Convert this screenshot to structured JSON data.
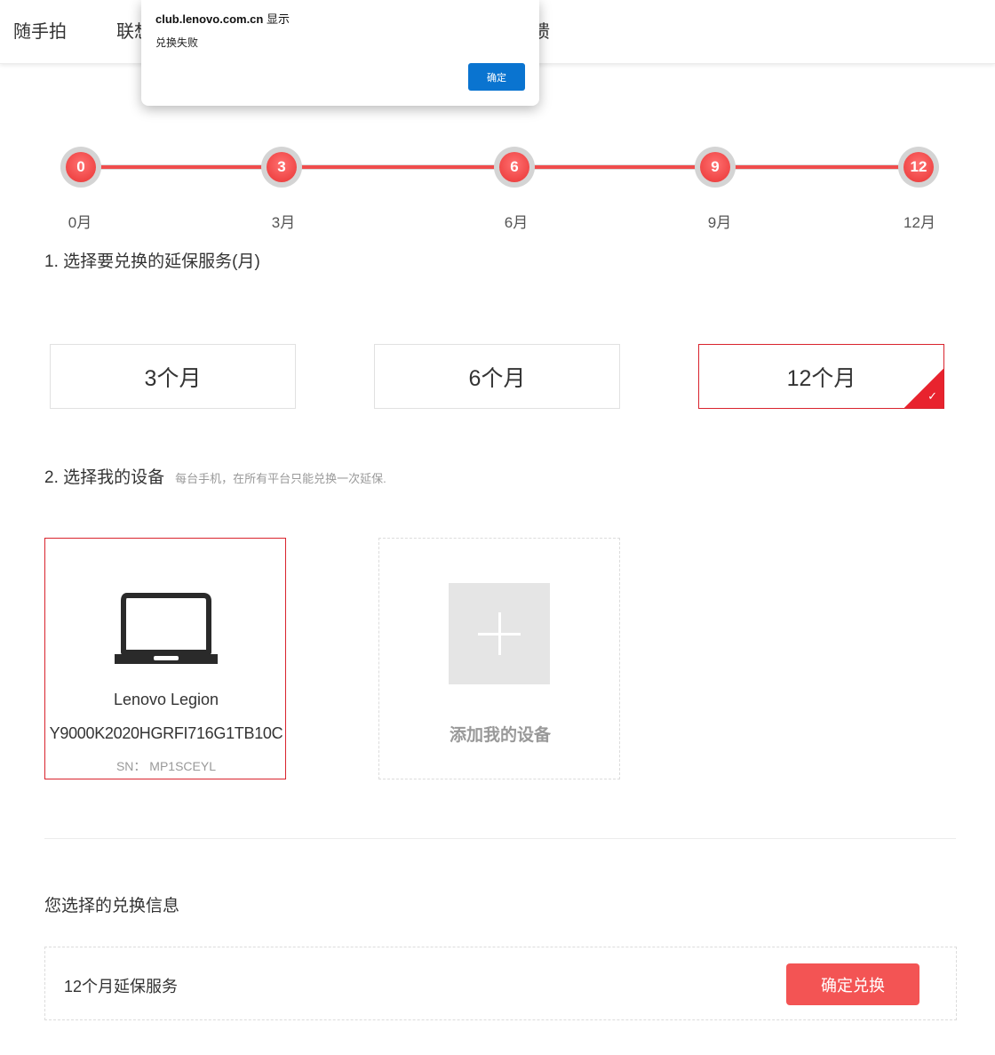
{
  "nav": {
    "items": [
      "随手拍",
      "联想",
      "馈"
    ]
  },
  "dialog": {
    "title_host": "club.lenovo.com.cn",
    "title_suffix": "显示",
    "message": "兑换失败",
    "ok_label": "确定"
  },
  "timeline": {
    "nodes": [
      {
        "value": "0",
        "label": "0月"
      },
      {
        "value": "3",
        "label": "3月"
      },
      {
        "value": "6",
        "label": "6月"
      },
      {
        "value": "9",
        "label": "9月"
      },
      {
        "value": "12",
        "label": "12月"
      }
    ]
  },
  "step1": {
    "title": "1. 选择要兑换的延保服务(月)",
    "options": [
      "3个月",
      "6个月",
      "12个月"
    ],
    "selected_index": 2
  },
  "step2": {
    "title": "2. 选择我的设备",
    "note": "每台手机，在所有平台只能兑换一次延保.",
    "device": {
      "name": "Lenovo Legion",
      "model": "Y9000K2020HGRFI716G1TB10C",
      "sn": "SN： MP1SCEYL"
    },
    "add_label": "添加我的设备"
  },
  "summary": {
    "title": "您选择的兑换信息",
    "selected_text": "12个月延保服务",
    "confirm_label": "确定兑换"
  },
  "colors": {
    "accent": "#e8232e",
    "button": "#f35454",
    "dialog_button": "#0a74d0"
  }
}
